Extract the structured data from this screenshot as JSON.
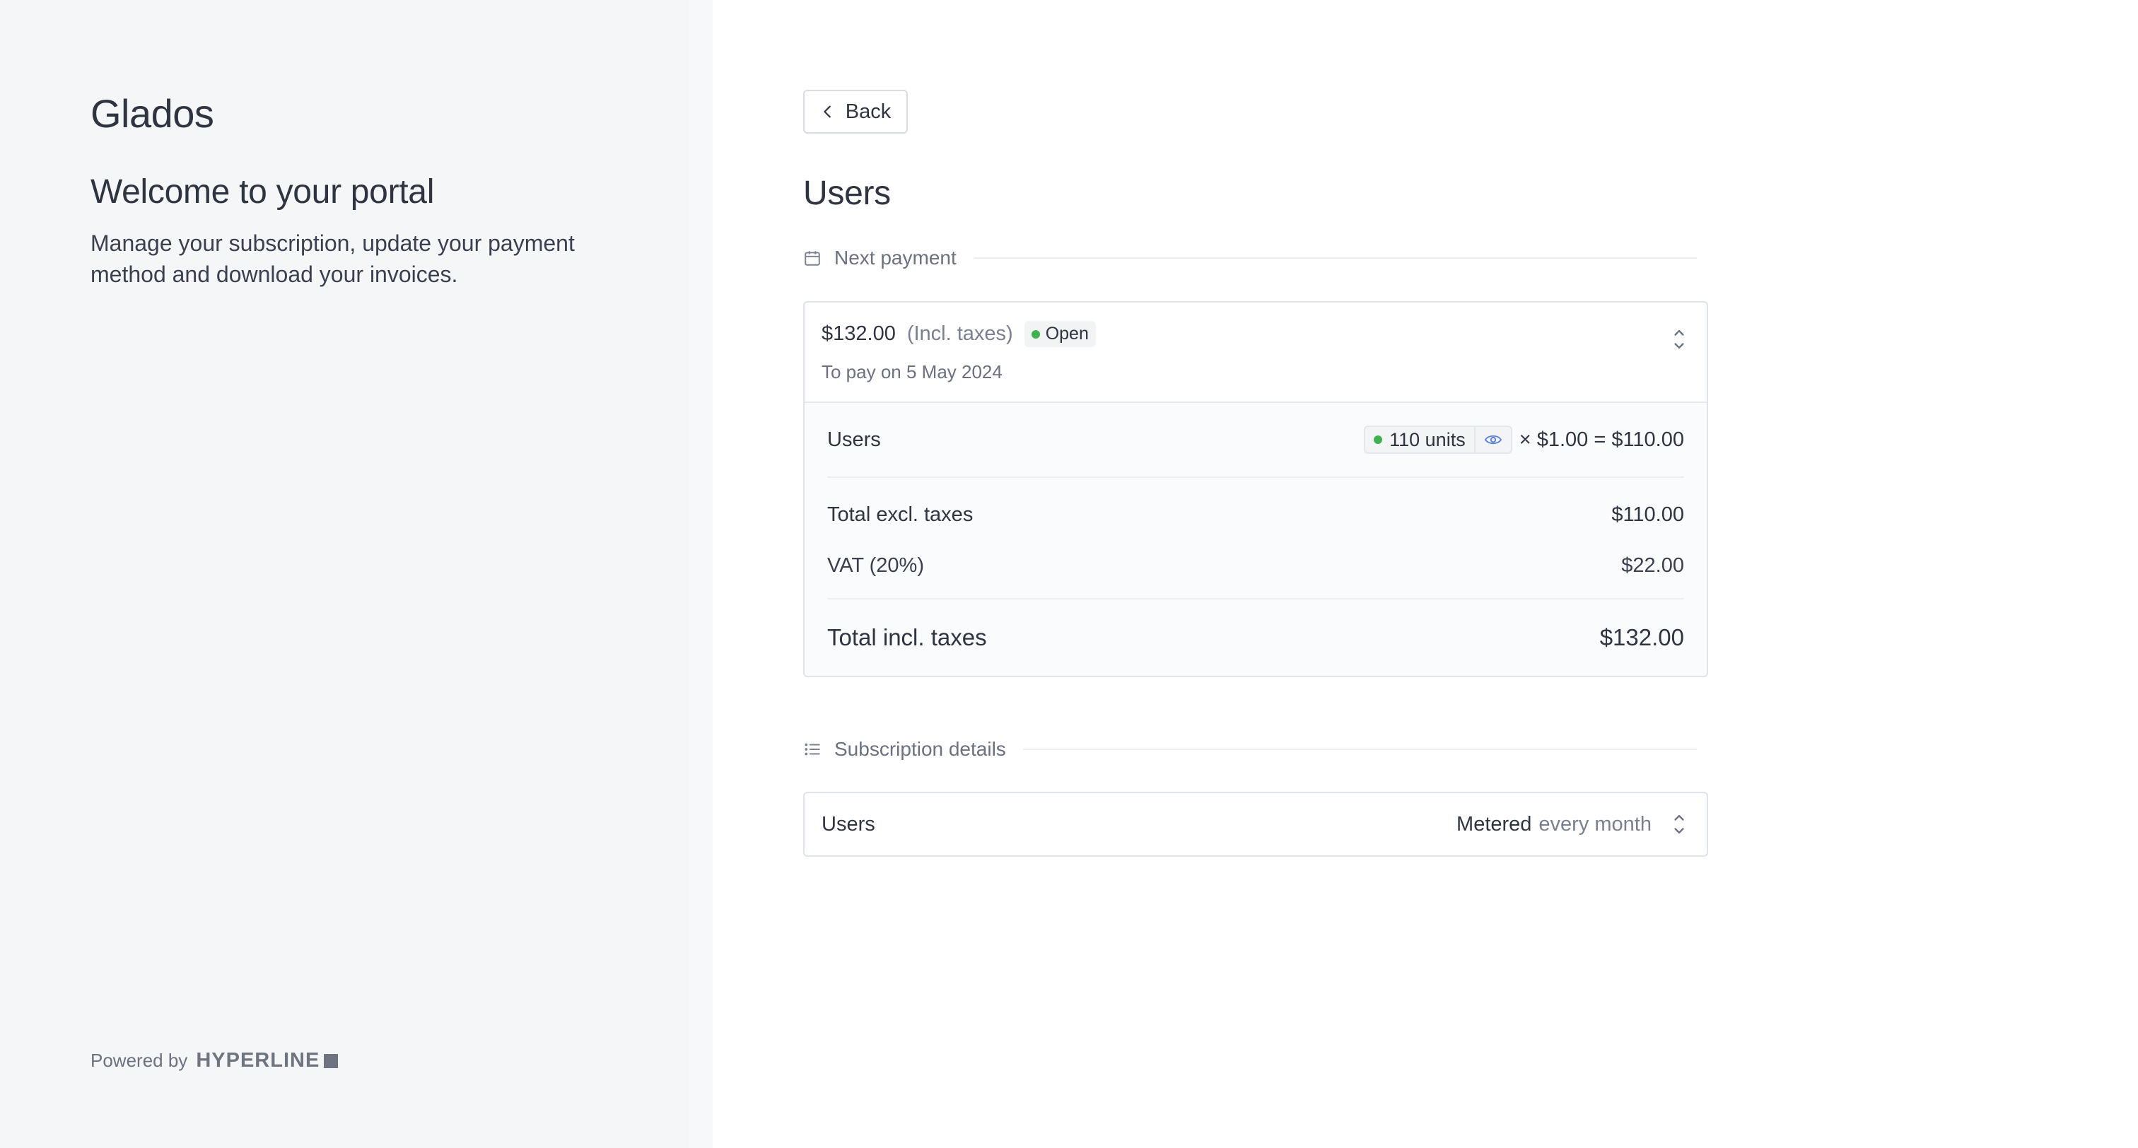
{
  "sidebar": {
    "brand": "Glados",
    "welcome_title": "Welcome to your portal",
    "welcome_subtitle": "Manage your subscription, update your payment method and download your invoices.",
    "powered_by": "Powered by",
    "powered_logo": "HYPERLINE"
  },
  "main": {
    "back_label": "Back",
    "title": "Users",
    "next_payment": {
      "heading": "Next payment",
      "amount": "$132.00",
      "incl_taxes": "(Incl. taxes)",
      "status": "Open",
      "due": "To pay on 5 May 2024",
      "line_item": {
        "name": "Users",
        "units": "110 units",
        "unit_price": "× $1.00 = $110.00"
      },
      "total_excl_label": "Total excl. taxes",
      "total_excl_value": "$110.00",
      "vat_label": "VAT (20%)",
      "vat_value": "$22.00",
      "total_incl_label": "Total incl. taxes",
      "total_incl_value": "$132.00"
    },
    "subscription": {
      "heading": "Subscription details",
      "item_name": "Users",
      "billing_type": "Metered",
      "frequency": "every month"
    }
  },
  "colors": {
    "status_open": "#3fb24f",
    "eye_icon": "#5b7fd6"
  }
}
